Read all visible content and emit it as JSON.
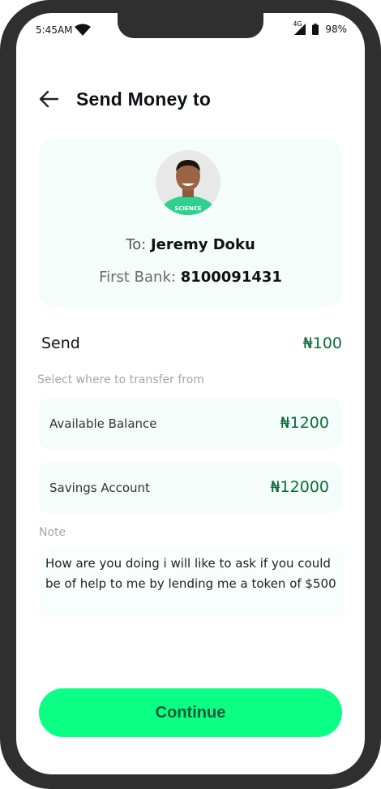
{
  "status_bar": {
    "time": "5:45AM",
    "network": "4G",
    "battery": "98%"
  },
  "header": {
    "title": "Send Money to"
  },
  "recipient": {
    "to_label": "To:",
    "name": "Jeremy Doku",
    "bank_label": "First Bank:",
    "account_number": "8100091431",
    "avatar_shirt_text": "SCIENCE"
  },
  "send": {
    "label": "Send",
    "amount": "₦100"
  },
  "source": {
    "hint": "Select where to transfer from",
    "accounts": [
      {
        "name": "Available Balance",
        "amount": "₦1200"
      },
      {
        "name": "Savings Account",
        "amount": "₦12000"
      }
    ]
  },
  "note": {
    "label": "Note",
    "text": "How are you doing i will like to ask if you could be of help to me by lending me a token of $500"
  },
  "actions": {
    "continue_label": "Continue"
  },
  "colors": {
    "accent": "#0aff84",
    "amount_green": "#0b6b3a",
    "card_bg": "#f4fdf9"
  }
}
